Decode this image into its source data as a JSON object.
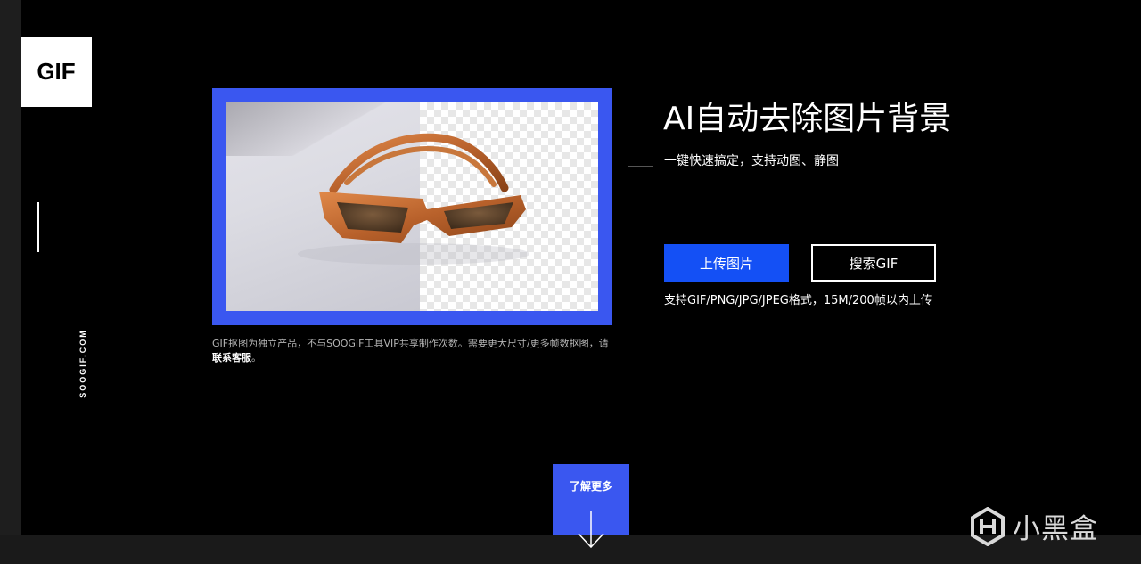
{
  "logo": {
    "text": "GIF"
  },
  "sidebar": {
    "site": "SOOGIF.COM"
  },
  "demo": {
    "note_prefix": "GIF抠图为独立产品，不与SOOGIF工具VIP共享制作次数。需要更大尺寸/更多帧数抠图，请 ",
    "contact_link": "联系客服",
    "note_suffix": "。"
  },
  "hero": {
    "title": "AI自动去除图片背景",
    "subtitle": "一键快速搞定，支持动图、静图"
  },
  "buttons": {
    "upload": "上传图片",
    "search": "搜索GIF"
  },
  "format_note": "支持GIF/PNG/JPG/JPEG格式，15M/200帧以内上传",
  "more": {
    "label": "了解更多"
  },
  "watermark": {
    "text": "小黑盒"
  },
  "colors": {
    "accent_blue": "#1450f5",
    "frame_blue": "#3a57f0",
    "background": "#000000"
  }
}
